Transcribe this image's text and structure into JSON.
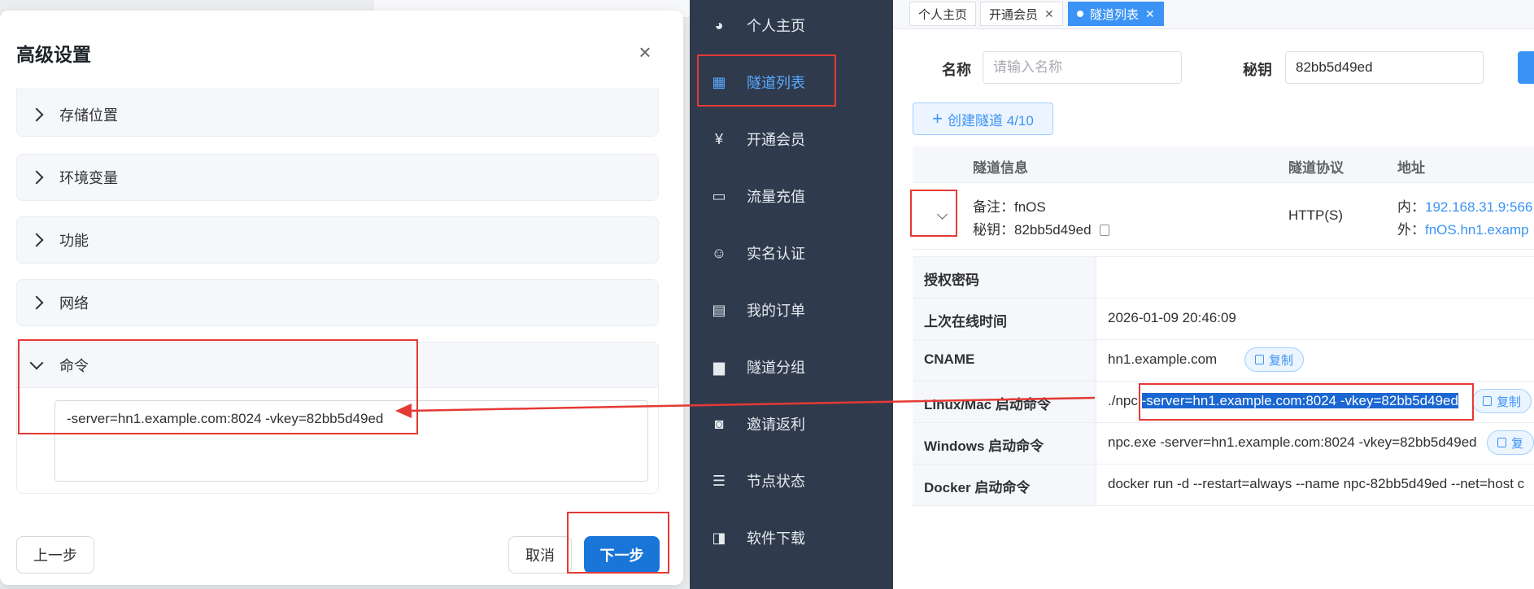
{
  "dialog": {
    "title": "高级设置",
    "close_icon": "close-icon",
    "sections": [
      {
        "label": "存储位置"
      },
      {
        "label": "环境变量"
      },
      {
        "label": "功能"
      },
      {
        "label": "网络"
      },
      {
        "label": "命令"
      }
    ],
    "command_value": "-server=hn1.example.com:8024 -vkey=82bb5d49ed",
    "prev_label": "上一步",
    "cancel_label": "取消",
    "next_label": "下一步"
  },
  "sidebar": {
    "items": [
      {
        "label": "个人主页",
        "icon": "dashboard-icon"
      },
      {
        "label": "隧道列表",
        "icon": "grid-icon"
      },
      {
        "label": "开通会员",
        "icon": "yen-icon"
      },
      {
        "label": "流量充值",
        "icon": "monitor-icon"
      },
      {
        "label": "实名认证",
        "icon": "user-icon"
      },
      {
        "label": "我的订单",
        "icon": "table-icon"
      },
      {
        "label": "隧道分组",
        "icon": "folder-icon"
      },
      {
        "label": "邀请返利",
        "icon": "gift-icon"
      },
      {
        "label": "节点状态",
        "icon": "list-icon"
      },
      {
        "label": "软件下载",
        "icon": "download-icon"
      }
    ],
    "active": "隧道列表"
  },
  "tabs": [
    {
      "label": "个人主页"
    },
    {
      "label": "开通会员"
    },
    {
      "label": "隧道列表"
    }
  ],
  "search": {
    "name_label": "名称",
    "name_placeholder": "请输入名称",
    "key_label": "秘钥",
    "key_value": "82bb5d49ed"
  },
  "create_button": "创建隧道 4/10",
  "table": {
    "headers": [
      "隧道信息",
      "隧道协议",
      "地址"
    ],
    "row": {
      "note": "备注：fnOS",
      "key": "秘钥：82bb5d49ed",
      "protocol": "HTTP(S)",
      "inner_prefix": "内：",
      "inner_addr": "192.168.31.9:566",
      "outer_prefix": "外：",
      "outer_addr": "fnOS.hn1.examp"
    }
  },
  "details": [
    {
      "key": "授权密码",
      "value": ""
    },
    {
      "key": "上次在线时间",
      "value": "2026-01-09 20:46:09"
    },
    {
      "key": "CNAME",
      "value": "hn1.example.com"
    },
    {
      "key": "Linux/Mac 启动命令",
      "prefix": "./npc ",
      "value": "-server=hn1.example.com:8024 -vkey=82bb5d49ed"
    },
    {
      "key": "Windows 启动命令",
      "value": "npc.exe -server=hn1.example.com:8024 -vkey=82bb5d49ed"
    },
    {
      "key": "Docker 启动命令",
      "value": "docker run -d --restart=always --name npc-82bb5d49ed --net=host c"
    }
  ],
  "copy_label": "复制",
  "copy_label_partial": "复",
  "colors": {
    "accent": "#3b93f5",
    "sidebar_bg": "#2f3b4d",
    "annotation": "#e53935",
    "primary_button": "#1976d8"
  }
}
